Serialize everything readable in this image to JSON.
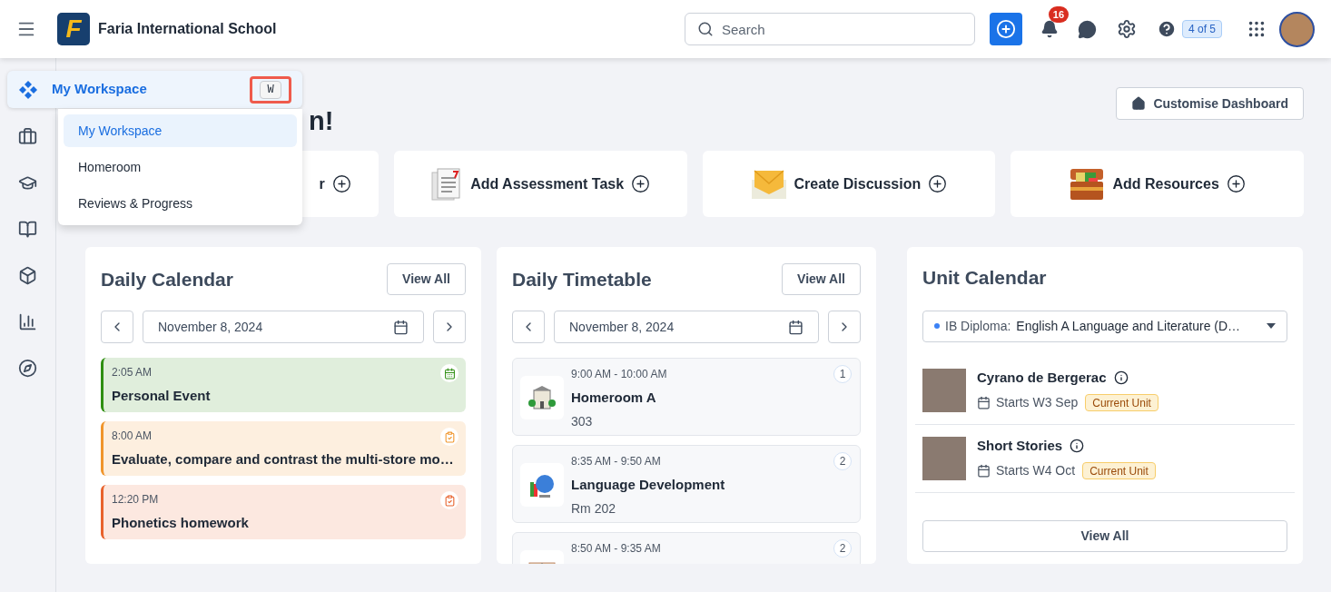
{
  "header": {
    "logo_letter": "F",
    "school_name": "Faria International School",
    "search": {
      "placeholder": "Search"
    },
    "notifications": "16",
    "progress_badge": "4 of 5"
  },
  "sidebar": {
    "active_item": {
      "label": "My Workspace",
      "shortcut": "W",
      "expanded": true,
      "menu": [
        {
          "label": "My Workspace",
          "selected": true
        },
        {
          "label": "Homeroom",
          "selected": false
        },
        {
          "label": "Reviews & Progress",
          "selected": false
        }
      ]
    }
  },
  "greeting": "n!",
  "customise_button": "Customise Dashboard",
  "quick_actions": [
    {
      "label": "r",
      "covered": true
    },
    {
      "label": "Add Assessment Task",
      "covered": false
    },
    {
      "label": "Create Discussion",
      "covered": false
    },
    {
      "label": "Add Resources",
      "covered": false
    }
  ],
  "daily_calendar": {
    "title": "Daily Calendar",
    "view_all": "View All",
    "date": "November 8, 2024",
    "events": [
      {
        "time": "2:05 AM",
        "title": "Personal Event",
        "kind": "event",
        "color": "#2f8f12"
      },
      {
        "time": "8:00 AM",
        "title": "Evaluate, compare and contrast the multi-store mo…",
        "kind": "task",
        "color": "#f0952b"
      },
      {
        "time": "12:20 PM",
        "title": "Phonetics homework",
        "kind": "task",
        "color": "#e8622c"
      }
    ]
  },
  "daily_timetable": {
    "title": "Daily Timetable",
    "view_all": "View All",
    "date": "November 8, 2024",
    "classes": [
      {
        "time": "9:00 AM - 10:00 AM",
        "title": "Homeroom A",
        "room": "303",
        "number": "1"
      },
      {
        "time": "8:35 AM - 9:50 AM",
        "title": "Language Development",
        "room": "Rm 202",
        "number": "2"
      },
      {
        "time": "8:50 AM - 9:35 AM",
        "number": "2"
      }
    ]
  },
  "unit_calendar": {
    "title": "Unit Calendar",
    "filter": {
      "label": "IB Diploma:",
      "value": "English A Language and Literature (D…"
    },
    "units": [
      {
        "title": "Cyrano de Bergerac",
        "starts": "Starts W3 Sep",
        "badge": "Current Unit"
      },
      {
        "title": "Short Stories",
        "starts": "Starts W4 Oct",
        "badge": "Current Unit"
      }
    ],
    "view_all": "View All"
  }
}
